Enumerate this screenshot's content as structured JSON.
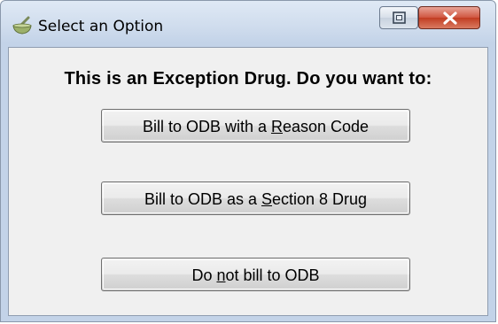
{
  "window": {
    "title": "Select an Option"
  },
  "dialog": {
    "prompt": "This is an Exception Drug.  Do you want to:",
    "options": [
      {
        "before": "Bill to ODB with a ",
        "access_key": "R",
        "after": "eason Code"
      },
      {
        "before": "Bill to ODB as a ",
        "access_key": "S",
        "after": "ection 8 Drug"
      },
      {
        "before": "Do ",
        "access_key": "n",
        "after": "ot bill to ODB"
      }
    ]
  },
  "icons": {
    "app": "mortar-pestle-icon",
    "restore": "restore-icon",
    "close": "close-icon"
  },
  "colors": {
    "close_button": "#c7432a",
    "client_background": "#f0f0f0",
    "frame": "#c3d3e8"
  }
}
